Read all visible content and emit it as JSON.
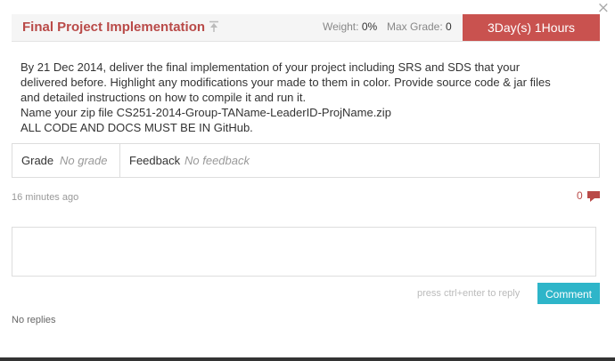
{
  "close_label": "×",
  "header": {
    "title": "Final Project Implementation",
    "weight_label": "Weight:",
    "weight_value": "0%",
    "max_grade_label": "Max Grade:",
    "max_grade_value": "0",
    "deadline": "3Day(s) 1Hours"
  },
  "description": [
    "By 21 Dec 2014, deliver the final implementation of your project including SRS and SDS that your",
    "delivered before. Highlight any modifications your made to them in color. Provide source code & jar files",
    "and detailed instructions on how to compile it and run it.",
    "Name your zip file CS251-2014-Group-TAName-LeaderID-ProjName.zip",
    "ALL CODE AND DOCS MUST BE IN GitHub."
  ],
  "grade": {
    "label": "Grade",
    "value": "No grade"
  },
  "feedback": {
    "label": "Feedback",
    "value": "No feedback"
  },
  "posted_time": "16 minutes ago",
  "comment_count": "0",
  "reply": {
    "hint": "press ctrl+enter to reply",
    "button_label": "Comment",
    "value": ""
  },
  "no_replies": "No replies",
  "colors": {
    "accent_red": "#c9524f",
    "title_red": "#b94a48",
    "button_teal": "#2eb5c9"
  }
}
